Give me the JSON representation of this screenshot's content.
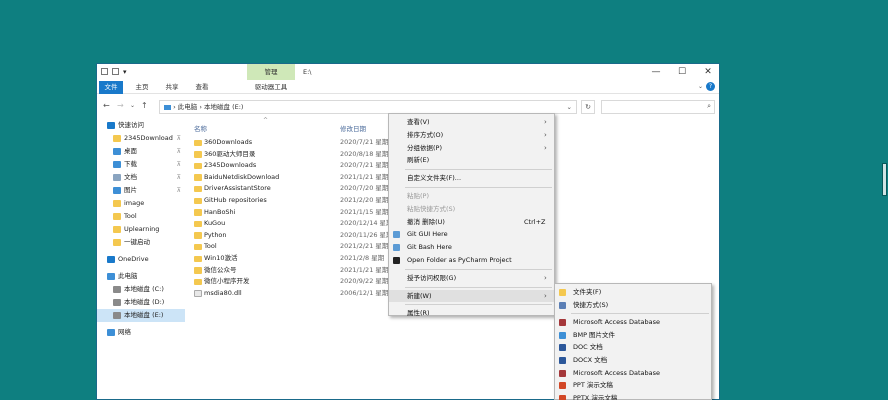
{
  "window": {
    "title": "E:\\",
    "ribbon_context_group": "管理",
    "controls": {
      "minimize": "—",
      "maximize": "☐",
      "close": "✕"
    }
  },
  "ribbon": {
    "tabs": [
      "文件",
      "主页",
      "共享",
      "查看",
      "驱动器工具"
    ],
    "help": "?"
  },
  "address": {
    "root": "此电脑",
    "sep": "›",
    "current": "本地磁盘 (E:)",
    "search_placeholder": ""
  },
  "navpane": {
    "items": [
      {
        "label": "快速访问",
        "icon": "star-icon",
        "color": "#1979ca",
        "pinned": false
      },
      {
        "label": "2345Download",
        "icon": "folder-icon",
        "color": "#f4c84f",
        "pinned": true
      },
      {
        "label": "桌面",
        "icon": "desktop-icon",
        "color": "#3d8fd6",
        "pinned": true
      },
      {
        "label": "下载",
        "icon": "download-icon",
        "color": "#3d8fd6",
        "pinned": true
      },
      {
        "label": "文档",
        "icon": "document-icon",
        "color": "#8aa4c0",
        "pinned": true
      },
      {
        "label": "图片",
        "icon": "picture-icon",
        "color": "#3d8fd6",
        "pinned": true
      },
      {
        "label": "image",
        "icon": "folder-icon",
        "color": "#f4c84f",
        "pinned": false
      },
      {
        "label": "Tool",
        "icon": "folder-icon",
        "color": "#f4c84f",
        "pinned": false
      },
      {
        "label": "Uplearning",
        "icon": "folder-icon",
        "color": "#f4c84f",
        "pinned": false
      },
      {
        "label": "一键启动",
        "icon": "folder-icon",
        "color": "#f4c84f",
        "pinned": false
      },
      {
        "label": "OneDrive",
        "icon": "cloud-icon",
        "color": "#1979ca",
        "pinned": false
      },
      {
        "label": "此电脑",
        "icon": "computer-icon",
        "color": "#3d8fd6",
        "pinned": false
      },
      {
        "label": "本地磁盘 (C:)",
        "icon": "drive-icon",
        "color": "#8a8a8a",
        "pinned": false
      },
      {
        "label": "本地磁盘 (D:)",
        "icon": "drive-icon",
        "color": "#8a8a8a",
        "pinned": false
      },
      {
        "label": "本地磁盘 (E:)",
        "icon": "drive-icon",
        "color": "#8a8a8a",
        "pinned": false,
        "selected": true
      },
      {
        "label": "网络",
        "icon": "network-icon",
        "color": "#3d8fd6",
        "pinned": false
      }
    ],
    "pin_glyph": "📌"
  },
  "filelist": {
    "columns": {
      "name": "名称",
      "date": "修改日期"
    },
    "rows": [
      {
        "name": "360Downloads",
        "date": "2020/7/21 星期",
        "type": "folder"
      },
      {
        "name": "360驱动大师目录",
        "date": "2020/8/18 星期",
        "type": "folder"
      },
      {
        "name": "2345Downloads",
        "date": "2020/7/21 星期",
        "type": "folder"
      },
      {
        "name": "BaiduNetdiskDownload",
        "date": "2021/1/21 星期",
        "type": "folder"
      },
      {
        "name": "DriverAssistantStore",
        "date": "2020/7/20 星期",
        "type": "folder"
      },
      {
        "name": "GitHub repositories",
        "date": "2021/2/20 星期",
        "type": "folder"
      },
      {
        "name": "HanBoShi",
        "date": "2021/1/15 星期",
        "type": "folder"
      },
      {
        "name": "KuGou",
        "date": "2020/12/14 星期",
        "type": "folder"
      },
      {
        "name": "Python",
        "date": "2020/11/26 星期",
        "type": "folder"
      },
      {
        "name": "Tool",
        "date": "2021/2/21 星期",
        "type": "folder"
      },
      {
        "name": "Win10激活",
        "date": "2021/2/8 星期",
        "type": "folder"
      },
      {
        "name": "微信公众号",
        "date": "2021/1/21 星期",
        "type": "folder"
      },
      {
        "name": "微信小程序开发",
        "date": "2020/9/22 星期",
        "type": "folder"
      },
      {
        "name": "msdia80.dll",
        "date": "2006/12/1 星期",
        "type": "dll"
      }
    ]
  },
  "context_menu": {
    "items": [
      {
        "label": "查看(V)",
        "submenu": true
      },
      {
        "label": "排序方式(O)",
        "submenu": true
      },
      {
        "label": "分组依据(P)",
        "submenu": true
      },
      {
        "label": "刷新(E)"
      },
      {
        "sep": true
      },
      {
        "label": "自定义文件夹(F)..."
      },
      {
        "sep": true
      },
      {
        "label": "粘贴(P)",
        "disabled": true
      },
      {
        "label": "粘贴快捷方式(S)",
        "disabled": true
      },
      {
        "label": "撤消 删除(U)",
        "shortcut": "Ctrl+Z"
      },
      {
        "label": "Git GUI Here",
        "icon": "git-gui-icon",
        "color": "#5b9bd5"
      },
      {
        "label": "Git Bash Here",
        "icon": "git-bash-icon",
        "color": "#5b9bd5"
      },
      {
        "label": "Open Folder as PyCharm Project",
        "icon": "pycharm-icon",
        "color": "#222222"
      },
      {
        "sep": true
      },
      {
        "label": "授予访问权限(G)",
        "submenu": true
      },
      {
        "sep": true
      },
      {
        "label": "新建(W)",
        "submenu": true,
        "highlighted": true
      },
      {
        "sep": true
      },
      {
        "label": "属性(R)"
      }
    ]
  },
  "new_submenu": {
    "items": [
      {
        "label": "文件夹(F)",
        "icon": "folder-icon",
        "color": "#f4c84f"
      },
      {
        "label": "快捷方式(S)",
        "icon": "shortcut-icon",
        "color": "#5b7fb5"
      },
      {
        "sep": true
      },
      {
        "label": "Microsoft Access Database",
        "icon": "access-icon",
        "color": "#a4373a"
      },
      {
        "label": "BMP 图片文件",
        "icon": "bmp-icon",
        "color": "#3d8fd6"
      },
      {
        "label": "DOC 文档",
        "icon": "doc-icon",
        "color": "#2b579a"
      },
      {
        "label": "DOCX 文档",
        "icon": "docx-icon",
        "color": "#2b579a"
      },
      {
        "label": "Microsoft Access Database",
        "icon": "access-icon",
        "color": "#a4373a"
      },
      {
        "label": "PPT 演示文稿",
        "icon": "ppt-icon",
        "color": "#d24726"
      },
      {
        "label": "PPTX 演示文稿",
        "icon": "pptx-icon",
        "color": "#d24726"
      }
    ]
  }
}
